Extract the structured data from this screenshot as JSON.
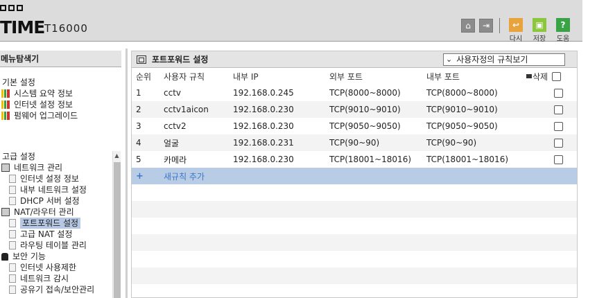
{
  "brand": {
    "name": "TIME",
    "model": "T16000"
  },
  "toolbar": {
    "home_icon": "home-icon",
    "logout_icon": "logout-icon",
    "revert_label": "다시",
    "save_label": "저장",
    "help_label": "도움",
    "colors": {
      "revert": "#e8a33c",
      "save": "#8cc63f",
      "help": "#3aa346"
    }
  },
  "sidebar": {
    "title": "메뉴탐색기",
    "basic": {
      "heading": "기본 설정",
      "items": [
        {
          "label": "시스템 요약 정보",
          "icon": "bar-chart-icon"
        },
        {
          "label": "인터넷 설정 정보",
          "icon": "globe-icon"
        },
        {
          "label": "펌웨어 업그레이드",
          "icon": "upgrade-icon"
        }
      ]
    },
    "advanced": {
      "heading": "고급 설정",
      "groups": [
        {
          "label": "네트워크 관리",
          "icon": "network-icon",
          "items": [
            "인터넷 설정 정보",
            "내부 네트워크 설정",
            "DHCP 서버 설정"
          ]
        },
        {
          "label": "NAT/라우터 관리",
          "icon": "router-icon",
          "items": [
            "포트포워드 설정",
            "고급 NAT 설정",
            "라우팅 테이블 관리"
          ]
        },
        {
          "label": "보안 기능",
          "icon": "lock-icon",
          "items": [
            "인터넷 사용제한",
            "네트워크 감시",
            "공유기 접속/보안관리"
          ]
        }
      ],
      "selected": "포트포워드 설정"
    }
  },
  "panel": {
    "title": "포트포워드 설정",
    "view_select": "사용자정의 규칙보기",
    "columns": [
      "순위",
      "사용자 규칙",
      "내부 IP",
      "외부 포트",
      "내부 포트",
      "삭제"
    ],
    "rows": [
      {
        "rank": "1",
        "name": "cctv",
        "ip": "192.168.0.245",
        "ext": "TCP(8000~8000)",
        "int": "TCP(8000~8000)"
      },
      {
        "rank": "2",
        "name": "cctv1aicon",
        "ip": "192.168.0.230",
        "ext": "TCP(9010~9010)",
        "int": "TCP(9010~9010)"
      },
      {
        "rank": "3",
        "name": "cctv2",
        "ip": "192.168.0.230",
        "ext": "TCP(9050~9050)",
        "int": "TCP(9050~9050)"
      },
      {
        "rank": "4",
        "name": "얼굴",
        "ip": "192.168.0.231",
        "ext": "TCP(90~90)",
        "int": "TCP(90~90)"
      },
      {
        "rank": "5",
        "name": "카메라",
        "ip": "192.168.0.230",
        "ext": "TCP(18001~18016)",
        "int": "TCP(18001~18016)"
      }
    ],
    "add_label": "새규칙 추가",
    "add_symbol": "+"
  }
}
